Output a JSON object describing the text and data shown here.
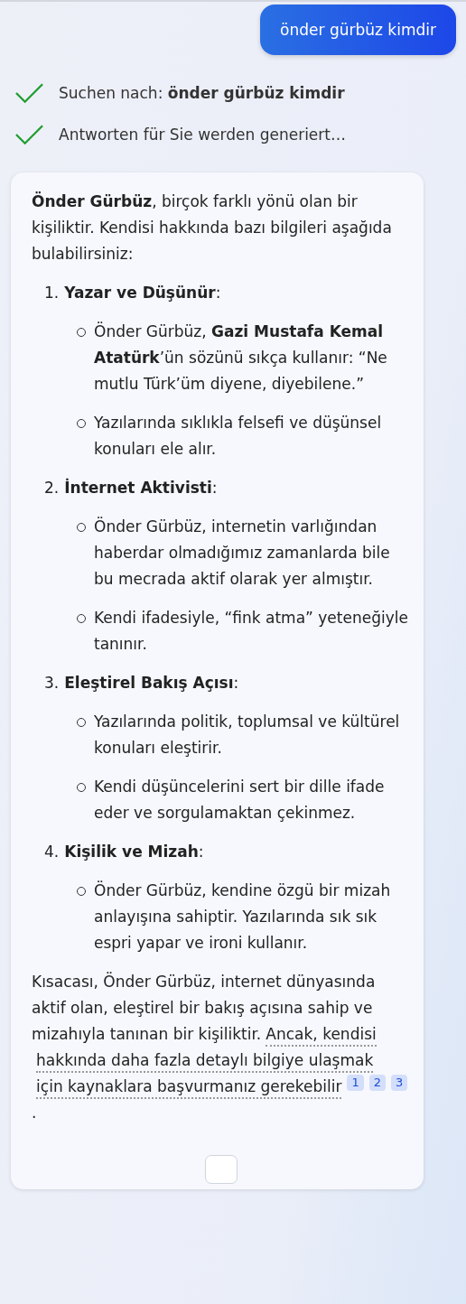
{
  "query": "önder gürbüz kimdir",
  "progress": [
    {
      "label": "Suchen nach: **önder gürbüz kimdir**",
      "done": true
    },
    {
      "label": "Antworten für Sie werden generiert…",
      "done": true
    }
  ],
  "answer": {
    "intro": "**Önder Gürbüz**, birçok farklı yönü olan bir kişiliktir. Kendisi hakkında bazı bilgileri aşağıda bulabilirsiniz:",
    "sections": [
      {
        "number": "1.",
        "title": "**Yazar ve Düşünür**:",
        "bullets": [
          "Önder Gürbüz, **Gazi Mustafa Kemal Atatürk**’ün sözünü sıkça kullanır: “Ne mutlu Türk’üm diyene, diyebilene.”",
          "Yazılarında sıklıkla felsefi ve düşünsel konuları ele alır."
        ]
      },
      {
        "number": "2.",
        "title": "**İnternet Aktivisti**:",
        "bullets": [
          "Önder Gürbüz, internetin varlığından haberdar olmadığımız zamanlarda bile bu mecrada aktif olarak yer almıştır.",
          "Kendi ifadesiyle, “fink atma” yeteneğiyle tanınır."
        ]
      },
      {
        "number": "3.",
        "title": "**Eleştirel Bakış Açısı**:",
        "bullets": [
          "Yazılarında politik, toplumsal ve kültürel konuları eleştirir.",
          "Kendi düşüncelerini sert bir dille ifade eder ve sorgulamaktan çekinmez."
        ]
      },
      {
        "number": "4.",
        "title": "**Kişilik ve Mizah**:",
        "bullets": [
          "Önder Gürbüz, kendine özgü bir mizah anlayışına sahiptir. Yazılarında sık sık espri yapar ve ironi kullanır."
        ]
      }
    ],
    "conclusion": {
      "text": "Kısacası, Önder Gürbüz, internet dünyasında aktif olan, eleştirel bir bakış açısına sahip ve mizahıyla tanınan bir kişiliktir.",
      "link_lines": [
        "Ancak, kendisi",
        "hakkında daha fazla detaylı bilgiye ulaşmak",
        "için kaynaklara başvurmanız gerekebilir"
      ],
      "citations": [
        "1",
        "2",
        "3"
      ],
      "end": "."
    }
  }
}
